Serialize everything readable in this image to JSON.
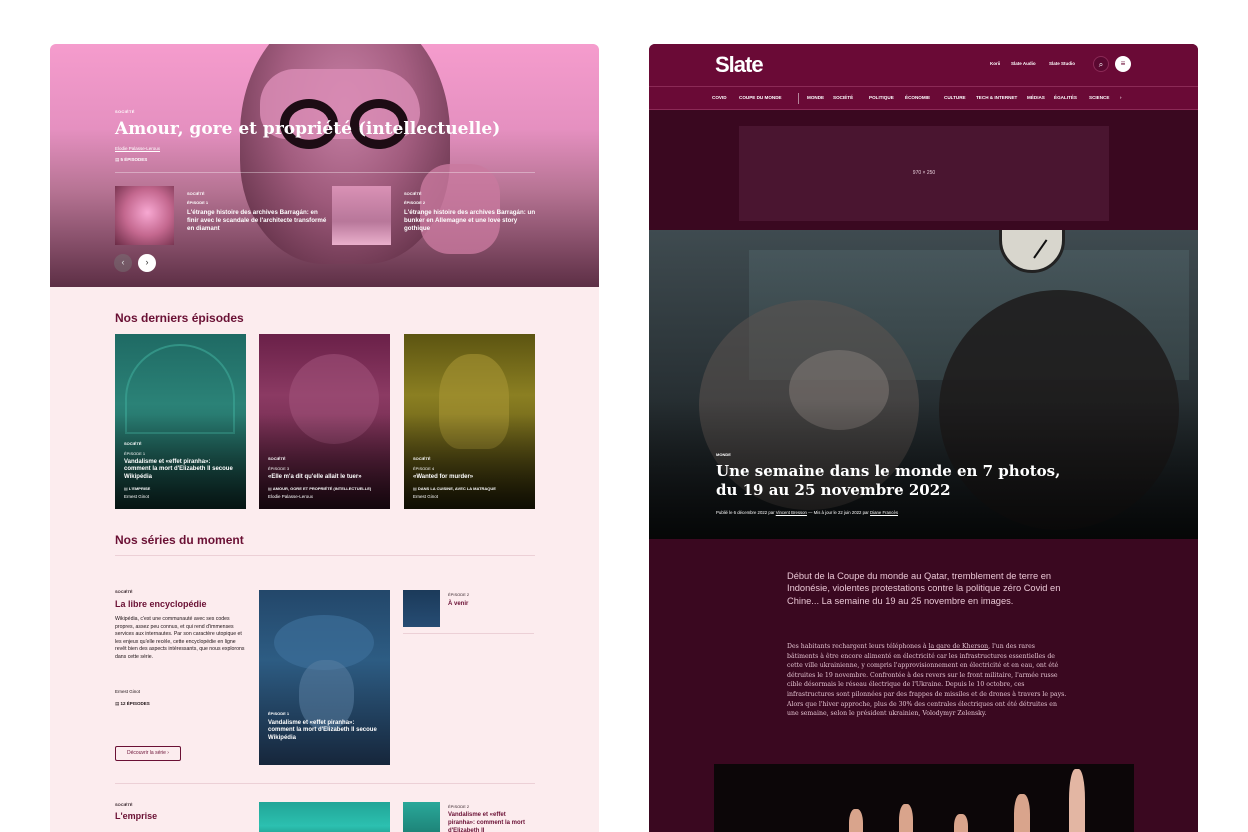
{
  "podcast": {
    "hero": {
      "kicker": "SOCIÉTÉ",
      "title": "Amour, gore et propriété (intellectuelle)",
      "author": "Elodie Palasse-Leroux",
      "episodes_count": "5 ÉPISODES",
      "episodes": [
        {
          "kicker": "SOCIÉTÉ",
          "num": "ÉPISODE 1",
          "title": "L'étrange histoire des archives Barragán: en finir avec le scandale de l'architecte transformé en diamant"
        },
        {
          "kicker": "SOCIÉTÉ",
          "num": "ÉPISODE 2",
          "title": "L'étrange histoire des archives Barragán: un bunker en Allemagne et une love story gothique"
        }
      ],
      "prev": "‹",
      "next": "›"
    },
    "latest": {
      "heading": "Nos derniers épisodes",
      "cards": [
        {
          "kicker": "SOCIÉTÉ",
          "num": "ÉPISODE 1",
          "title": "Vandalisme et «effet piranha»: comment la mort d'Elizabeth II secoue Wikipédia",
          "series": "L'EMPRISE",
          "author": "Ernest Ginot"
        },
        {
          "kicker": "SOCIÉTÉ",
          "num": "ÉPISODE 3",
          "title": "«Elle m'a dit qu'elle allait le tuer»",
          "series": "AMOUR, GORE ET PROPRIÉTÉ (INTELLECTUELLE)",
          "author": "Elodie Palasse-Leroux"
        },
        {
          "kicker": "SOCIÉTÉ",
          "num": "ÉPISODE 4",
          "title": "«Wanted for murder»",
          "series": "DANS LA CUISINE, AVEC LA MATRAQUE",
          "author": "Ernest Ginot"
        }
      ]
    },
    "series": {
      "heading": "Nos séries du moment",
      "first": {
        "kicker": "SOCIÉTÉ",
        "title": "La libre encyclopédie",
        "description": "Wikipédia, c'est une communauté avec ses codes propres, assez peu connus, et qui rend d'immenses services aux internautes. Par son caractère utopique et les enjeux qu'elle recèle, cette encyclopédie en ligne revêt bien des aspects intéressants, que nous explorons dans cette série.",
        "author": "Ernest Ginot",
        "count": "12 ÉPISODES",
        "button": "Découvrir la série ›",
        "card_num": "ÉPISODE 1",
        "card_title": "Vandalisme et «effet piranha»: comment la mort d'Elizabeth II secoue Wikipédia",
        "side_num": "ÉPISODE 2",
        "side_title": "À venir"
      },
      "second": {
        "kicker": "SOCIÉTÉ",
        "title": "L'emprise",
        "side_num": "ÉPISODE 2",
        "side_title": "Vandalisme et «effet piranha»: comment la mort d'Elizabeth II"
      }
    }
  },
  "slate": {
    "logo": "Slate",
    "top_links": [
      "Korii",
      "Slate Audio",
      "Slate Studio"
    ],
    "search_icon": "⌕",
    "menu_icon": "≡",
    "nav": [
      "COVID",
      "COUPE DU MONDE",
      "MONDE",
      "SOCIÉTÉ",
      "POLITIQUE",
      "ÉCONOMIE",
      "CULTURE",
      "TECH & INTERNET",
      "MÉDIAS",
      "ÉGALITÉS",
      "SCIENCE"
    ],
    "nav_more": "›",
    "ad_label": "970 × 250",
    "article": {
      "kicker": "MONDE",
      "title": "Une semaine dans le monde en 7 photos, du 19 au 25 novembre 2022",
      "published": "Publié le 6 décembre 2022 par",
      "author": "Vincent Bresson",
      "sep": "—",
      "updated": "Mis à jour le 22 juin 2022 par",
      "editor": "Diane Francès",
      "lead": "Début de la Coupe du monde au Qatar, tremblement de terre en Indonésie, violentes protestations contre la politique zéro Covid en Chine... La semaine du 19 au 25 novembre en images.",
      "body_pre": "Des habitants rechargent leurs téléphones à",
      "body_link": "la gare de Kherson",
      "body_post": ", l'un des rares bâtiments à être encore alimenté en électricité car les infrastructures essentielles de cette ville ukrainienne, y compris l'approvisionnement en électricité et en eau, ont été détruites le 19 novembre. Confrontée à des revers sur le front militaire, l'armée russe cible désormais le réseau électrique de l'Ukraine. Depuis le 10 octobre, ces infrastructures sont pilonnées par des frappes de missiles et de drones à travers le pays. Alors que l'hiver approche, plus de 30% des centrales électriques ont été détruites en une semaine, selon le président ukrainien, Volodymyr Zelensky."
    }
  }
}
